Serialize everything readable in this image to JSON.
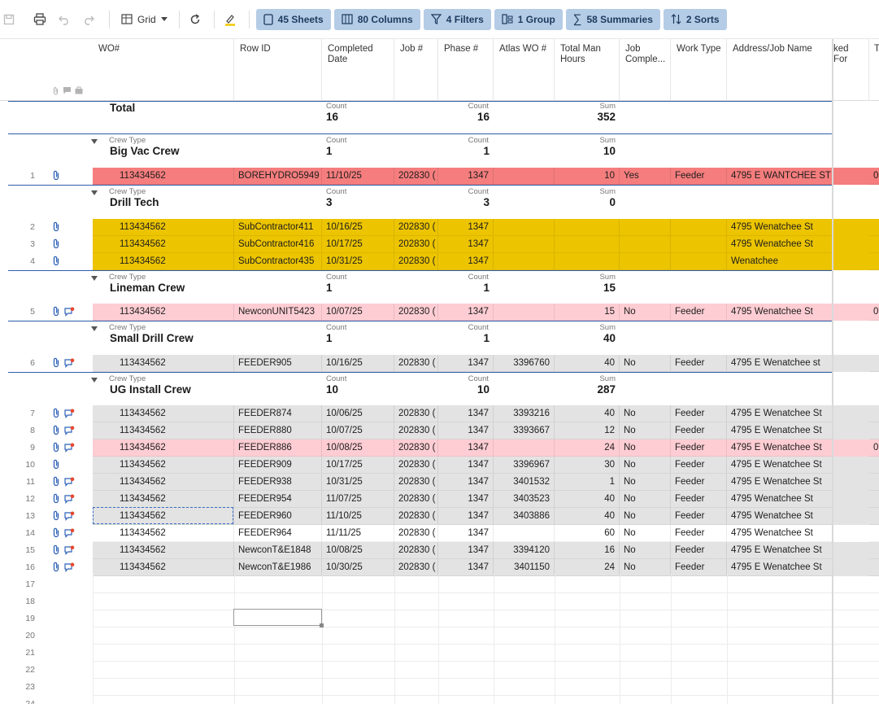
{
  "toolbar": {
    "grid_label": "Grid",
    "pills": [
      {
        "label": "45 Sheets",
        "icon": "sheet-icon"
      },
      {
        "label": "80 Columns",
        "icon": "columns-icon"
      },
      {
        "label": "4 Filters",
        "icon": "filter-icon"
      },
      {
        "label": "1 Group",
        "icon": "group-icon"
      },
      {
        "label": "58 Summaries",
        "icon": "sigma-icon"
      },
      {
        "label": "2 Sorts",
        "icon": "sort-icon"
      }
    ]
  },
  "columns": {
    "wo": "WO#",
    "row_id": "Row ID",
    "completed_1": "Completed",
    "completed_2": "Date",
    "job": "Job #",
    "phase": "Phase #",
    "atlas": "Atlas WO #",
    "hours_1": "Total Man",
    "hours_2": "Hours",
    "jobc_1": "Job",
    "jobc_2": "Comple...",
    "work_type": "Work Type",
    "address": "Address/Job Name",
    "ked": "ked For",
    "t": "T"
  },
  "total": {
    "label": "Total",
    "count_label": "Count",
    "sum_label": "Sum",
    "count1": "16",
    "count2": "16",
    "sum": "352"
  },
  "groups": [
    {
      "type_label": "Crew Type",
      "name": "Big Vac Crew",
      "count_label": "Count",
      "sum_label": "Sum",
      "count1": "1",
      "count2": "1",
      "sum": "10"
    },
    {
      "type_label": "Crew Type",
      "name": "Drill Tech",
      "count_label": "Count",
      "sum_label": "Sum",
      "count1": "3",
      "count2": "3",
      "sum": "0"
    },
    {
      "type_label": "Crew Type",
      "name": "Lineman Crew",
      "count_label": "Count",
      "sum_label": "Sum",
      "count1": "1",
      "count2": "1",
      "sum": "15"
    },
    {
      "type_label": "Crew Type",
      "name": "Small Drill Crew",
      "count_label": "Count",
      "sum_label": "Sum",
      "count1": "1",
      "count2": "1",
      "sum": "40"
    },
    {
      "type_label": "Crew Type",
      "name": "UG Install Crew",
      "count_label": "Count",
      "sum_label": "Sum",
      "count1": "10",
      "count2": "10",
      "sum": "287"
    }
  ],
  "rows": [
    {
      "n": "1",
      "wo": "113434562",
      "rid": "BOREHYDRO5949",
      "date": "11/10/25",
      "job": "202830 (",
      "phase": "1347",
      "atlas": "",
      "hours": "10",
      "jc": "Yes",
      "wt": "Feeder",
      "addr": "4795 E WANTCHEE ST",
      "x": "0",
      "color": "#f57d7d",
      "comment": false
    },
    {
      "n": "2",
      "wo": "113434562",
      "rid": "SubContractor411",
      "date": "10/16/25",
      "job": "202830 (",
      "phase": "1347",
      "atlas": "",
      "hours": "",
      "jc": "",
      "wt": "",
      "addr": "4795 Wenatchee St",
      "x": "",
      "color": "#ecc400",
      "comment": false
    },
    {
      "n": "3",
      "wo": "113434562",
      "rid": "SubContractor416",
      "date": "10/17/25",
      "job": "202830 (",
      "phase": "1347",
      "atlas": "",
      "hours": "",
      "jc": "",
      "wt": "",
      "addr": "4795 Wenatchee St",
      "x": "",
      "color": "#ecc400",
      "comment": false
    },
    {
      "n": "4",
      "wo": "113434562",
      "rid": "SubContractor435",
      "date": "10/31/25",
      "job": "202830 (",
      "phase": "1347",
      "atlas": "",
      "hours": "",
      "jc": "",
      "wt": "",
      "addr": "Wenatchee",
      "x": "",
      "color": "#ecc400",
      "comment": false
    },
    {
      "n": "5",
      "wo": "113434562",
      "rid": "NewconUNIT5423",
      "date": "10/07/25",
      "job": "202830 (",
      "phase": "1347",
      "atlas": "",
      "hours": "15",
      "jc": "No",
      "wt": "Feeder",
      "addr": "4795 Wenatchee St",
      "x": "0",
      "color": "#fdcdd3",
      "comment": true
    },
    {
      "n": "6",
      "wo": "113434562",
      "rid": "FEEDER905",
      "date": "10/16/25",
      "job": "202830 (",
      "phase": "1347",
      "atlas": "3396760",
      "hours": "40",
      "jc": "No",
      "wt": "Feeder",
      "addr": "4795 E Wenatchee st",
      "x": "",
      "color": "#e3e3e3",
      "comment": true
    },
    {
      "n": "7",
      "wo": "113434562",
      "rid": "FEEDER874",
      "date": "10/06/25",
      "job": "202830 (",
      "phase": "1347",
      "atlas": "3393216",
      "hours": "40",
      "jc": "No",
      "wt": "Feeder",
      "addr": "4795 E Wenatchee St",
      "x": "",
      "color": "#e3e3e3",
      "comment": true
    },
    {
      "n": "8",
      "wo": "113434562",
      "rid": "FEEDER880",
      "date": "10/07/25",
      "job": "202830 (",
      "phase": "1347",
      "atlas": "3393667",
      "hours": "12",
      "jc": "No",
      "wt": "Feeder",
      "addr": "4795 E Wenatchee St",
      "x": "",
      "color": "#e3e3e3",
      "comment": true
    },
    {
      "n": "9",
      "wo": "113434562",
      "rid": "FEEDER886",
      "date": "10/08/25",
      "job": "202830 (",
      "phase": "1347",
      "atlas": "",
      "hours": "24",
      "jc": "No",
      "wt": "Feeder",
      "addr": "4795 E Wenatchee St",
      "x": "0",
      "color": "#fdcdd3",
      "comment": true
    },
    {
      "n": "10",
      "wo": "113434562",
      "rid": "FEEDER909",
      "date": "10/17/25",
      "job": "202830 (",
      "phase": "1347",
      "atlas": "3396967",
      "hours": "30",
      "jc": "No",
      "wt": "Feeder",
      "addr": "4795 E Wenatchee St",
      "x": "",
      "color": "#e3e3e3",
      "comment": false
    },
    {
      "n": "11",
      "wo": "113434562",
      "rid": "FEEDER938",
      "date": "10/31/25",
      "job": "202830 (",
      "phase": "1347",
      "atlas": "3401532",
      "hours": "1",
      "jc": "No",
      "wt": "Feeder",
      "addr": "4795 E Wenatchee St",
      "x": "",
      "color": "#e3e3e3",
      "comment": true
    },
    {
      "n": "12",
      "wo": "113434562",
      "rid": "FEEDER954",
      "date": "11/07/25",
      "job": "202830 (",
      "phase": "1347",
      "atlas": "3403523",
      "hours": "40",
      "jc": "No",
      "wt": "Feeder",
      "addr": "4795 Wenatchee St",
      "x": "",
      "color": "#e3e3e3",
      "comment": true
    },
    {
      "n": "13",
      "wo": "113434562",
      "rid": "FEEDER960",
      "date": "11/10/25",
      "job": "202830 (",
      "phase": "1347",
      "atlas": "3403886",
      "hours": "40",
      "jc": "No",
      "wt": "Feeder",
      "addr": "4795 Wenatchee St",
      "x": "",
      "color": "#e3e3e3",
      "comment": true
    },
    {
      "n": "14",
      "wo": "113434562",
      "rid": "FEEDER964",
      "date": "11/11/25",
      "job": "202830 (",
      "phase": "1347",
      "atlas": "",
      "hours": "60",
      "jc": "No",
      "wt": "Feeder",
      "addr": "4795 Wenatchee St",
      "x": "",
      "color": "#ffffff",
      "comment": true
    },
    {
      "n": "15",
      "wo": "113434562",
      "rid": "NewconT&E1848",
      "date": "10/08/25",
      "job": "202830 (",
      "phase": "1347",
      "atlas": "3394120",
      "hours": "16",
      "jc": "No",
      "wt": "Feeder",
      "addr": "4795 E Wenatchee St",
      "x": "",
      "color": "#e3e3e3",
      "comment": true
    },
    {
      "n": "16",
      "wo": "113434562",
      "rid": "NewconT&E1986",
      "date": "10/30/25",
      "job": "202830 (",
      "phase": "1347",
      "atlas": "3401150",
      "hours": "24",
      "jc": "No",
      "wt": "Feeder",
      "addr": "4795 E Wenatchee St",
      "x": "",
      "color": "#e3e3e3",
      "comment": true
    }
  ],
  "empty_rows": [
    "17",
    "18",
    "19",
    "20",
    "21",
    "22",
    "23",
    "24"
  ]
}
